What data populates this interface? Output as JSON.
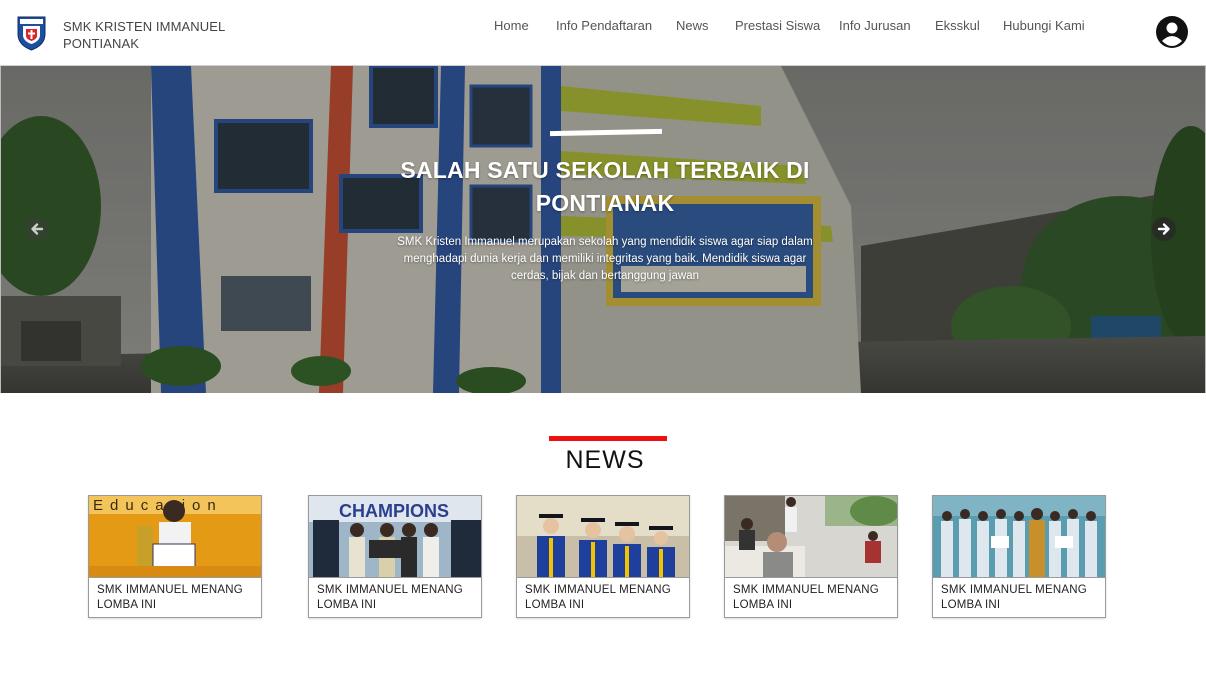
{
  "header": {
    "brand_line1": "SMK KRISTEN IMMANUEL",
    "brand_line2": "PONTIANAK",
    "nav": [
      {
        "label": "Home"
      },
      {
        "label": "Info Pendaftaran"
      },
      {
        "label": "News"
      },
      {
        "label": "Prestasi Siswa"
      },
      {
        "label": "Info Jurusan"
      },
      {
        "label": "Eksskul"
      },
      {
        "label": "Hubungi Kami"
      }
    ],
    "account_icon": "account-circle-icon"
  },
  "hero": {
    "title": "SALAH SATU SEKOLAH TERBAIK DI PONTIANAK",
    "description": "SMK Kristen Immanuel merupakan sekolah yang mendidik siswa agar siap dalam menghadapi dunia kerja dan memiliki integritas yang baik. Mendidik siswa agar cerdas, bijak dan bertanggung jawan",
    "prev_icon": "arrow-left-circle-icon",
    "next_icon": "arrow-right-circle-icon"
  },
  "news": {
    "title": "NEWS",
    "accent_color": "#ee1010",
    "cards": [
      {
        "caption": "SMK IMMANUEL MENANG LOMBA INI",
        "thumb_text": "Education"
      },
      {
        "caption": "SMK IMMANUEL MENANG LOMBA INI",
        "thumb_text": "CHAMPIONS"
      },
      {
        "caption": "SMK IMMANUEL MENANG LOMBA INI"
      },
      {
        "caption": "SMK IMMANUEL MENANG LOMBA INI"
      },
      {
        "caption": "SMK IMMANUEL MENANG LOMBA INI"
      }
    ]
  }
}
